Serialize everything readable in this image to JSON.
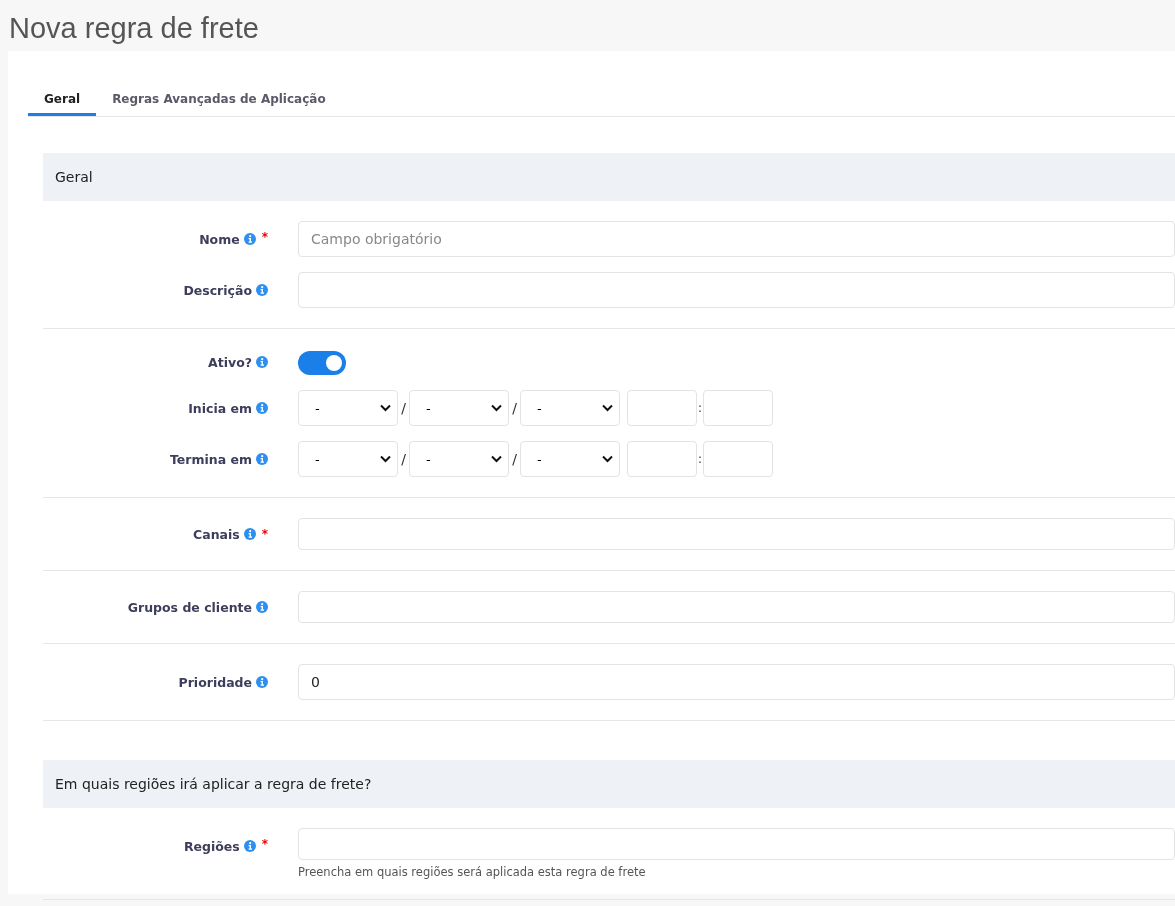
{
  "page_title": "Nova regra de frete",
  "tabs": [
    {
      "label": "Geral",
      "selected": true
    },
    {
      "label": "Regras Avançadas de Aplicação",
      "selected": false
    }
  ],
  "sections": [
    {
      "title": "Geral",
      "groups": [
        [
          {
            "kind": "text",
            "label": "Nome",
            "required_mark": "*",
            "placeholder": "Campo obrigatório"
          },
          {
            "kind": "text",
            "label": "Descrição"
          }
        ],
        [
          {
            "kind": "toggle",
            "label": "Ativo?",
            "on": true
          },
          {
            "kind": "datetime",
            "label": "Inicia em",
            "selects": [
              "-",
              "-",
              "-"
            ],
            "date_separators": [
              "/",
              "/"
            ],
            "time_separator": ":"
          },
          {
            "kind": "datetime",
            "label": "Termina em",
            "selects": [
              "-",
              "-",
              "-"
            ],
            "date_separators": [
              "/",
              "/"
            ],
            "time_separator": ":"
          }
        ],
        [
          {
            "kind": "multiselect",
            "label": "Canais",
            "required_mark": "*"
          }
        ],
        [
          {
            "kind": "multiselect",
            "label": "Grupos de cliente"
          }
        ],
        [
          {
            "kind": "text",
            "label": "Prioridade",
            "value": "0"
          }
        ]
      ]
    },
    {
      "title": "Em quais regiões irá aplicar a regra de frete?",
      "groups": [
        [
          {
            "kind": "multiselect",
            "label": "Regiões",
            "required_mark": "*",
            "help": "Preencha em quais regiões será aplicada esta regra de frete"
          }
        ]
      ]
    }
  ]
}
